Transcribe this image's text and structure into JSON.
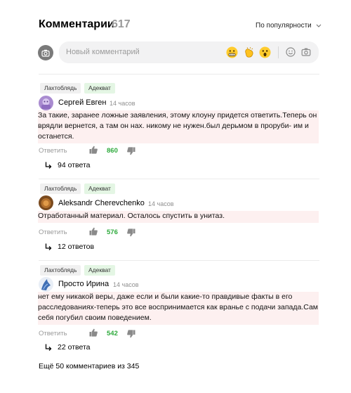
{
  "header": {
    "title": "Комментарии",
    "count": "617",
    "sort_label": "По популярности"
  },
  "composer": {
    "placeholder": "Новый комментарий"
  },
  "comments": [
    {
      "tags": [
        "Лахтоблядь",
        "Адекват"
      ],
      "author": "Сергей Евген",
      "time": "14 часов",
      "text": "За такие, заранее ложные заявления, этому клоуну придется ответить.Теперь он врядли вернется, а там он нах. никому не нужен.был дерьмом в проруби- им и останется.",
      "reply_label": "Ответить",
      "likes": "860",
      "thread": "94 ответа"
    },
    {
      "tags": [
        "Лахтоблядь",
        "Адекват"
      ],
      "author": "Aleksandr Cherevchenko",
      "time": "14 часов",
      "text": "Отработанный материал. Осталось спустить в унитаз.",
      "reply_label": "Ответить",
      "likes": "576",
      "thread": "12 ответов"
    },
    {
      "tags": [
        "Лахтоблядь",
        "Адекват"
      ],
      "author": "Просто Ирина",
      "time": "14 часов",
      "text": "нет ему никакой веры, даже если и были какие-то правдивые факты в его расследованиях-теперь это все воспринимается как вранье с подачи запада.Сам себя погубил своим поведением.",
      "reply_label": "Ответить",
      "likes": "542",
      "thread": "22 ответа"
    }
  ],
  "footer": {
    "more_label": "Ещё 50 комментариев из 345"
  },
  "colors": {
    "likes_green": "#2eaa3c",
    "comment_bg": "#fdf0f0",
    "tag_green_bg": "#e4f6e4"
  }
}
